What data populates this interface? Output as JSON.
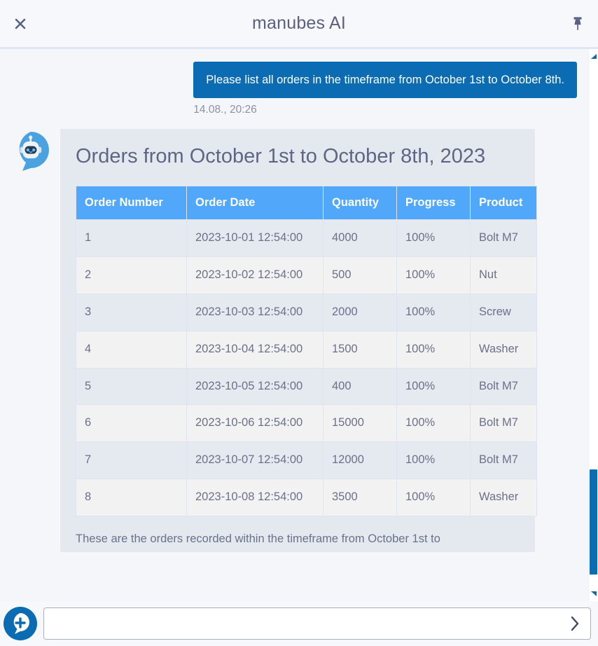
{
  "header": {
    "title": "manubes AI",
    "close_label": "Close",
    "pin_label": "Pin"
  },
  "conversation": {
    "user_message": {
      "text": "Please list all orders in the timeframe from October 1st to October 8th.",
      "timestamp": "14.08., 20:26"
    },
    "bot_message": {
      "title": "Orders from October 1st to October 8th, 2023",
      "outro": "These are the orders recorded within the timeframe from October 1st to",
      "table": {
        "columns": [
          "Order Number",
          "Order Date",
          "Quantity",
          "Progress",
          "Product"
        ],
        "rows": [
          [
            "1",
            "2023-10-01 12:54:00",
            "4000",
            "100%",
            "Bolt M7"
          ],
          [
            "2",
            "2023-10-02 12:54:00",
            "500",
            "100%",
            "Nut"
          ],
          [
            "3",
            "2023-10-03 12:54:00",
            "2000",
            "100%",
            "Screw"
          ],
          [
            "4",
            "2023-10-04 12:54:00",
            "1500",
            "100%",
            "Washer"
          ],
          [
            "5",
            "2023-10-05 12:54:00",
            "400",
            "100%",
            "Bolt M7"
          ],
          [
            "6",
            "2023-10-06 12:54:00",
            "15000",
            "100%",
            "Bolt M7"
          ],
          [
            "7",
            "2023-10-07 12:54:00",
            "12000",
            "100%",
            "Bolt M7"
          ],
          [
            "8",
            "2023-10-08 12:54:00",
            "3500",
            "100%",
            "Washer"
          ]
        ]
      }
    }
  },
  "composer": {
    "new_chat_label": "New chat",
    "input_value": "",
    "input_placeholder": "",
    "send_label": "Send"
  },
  "colors": {
    "accent_blue": "#0b6cb3",
    "table_header_blue": "#51a7f9",
    "page_bg": "#f4f6fa",
    "card_bg": "#e4e9ef",
    "row_odd": "#e5e9f0",
    "row_even": "#f2f2f2",
    "text_muted": "#6b7189"
  }
}
